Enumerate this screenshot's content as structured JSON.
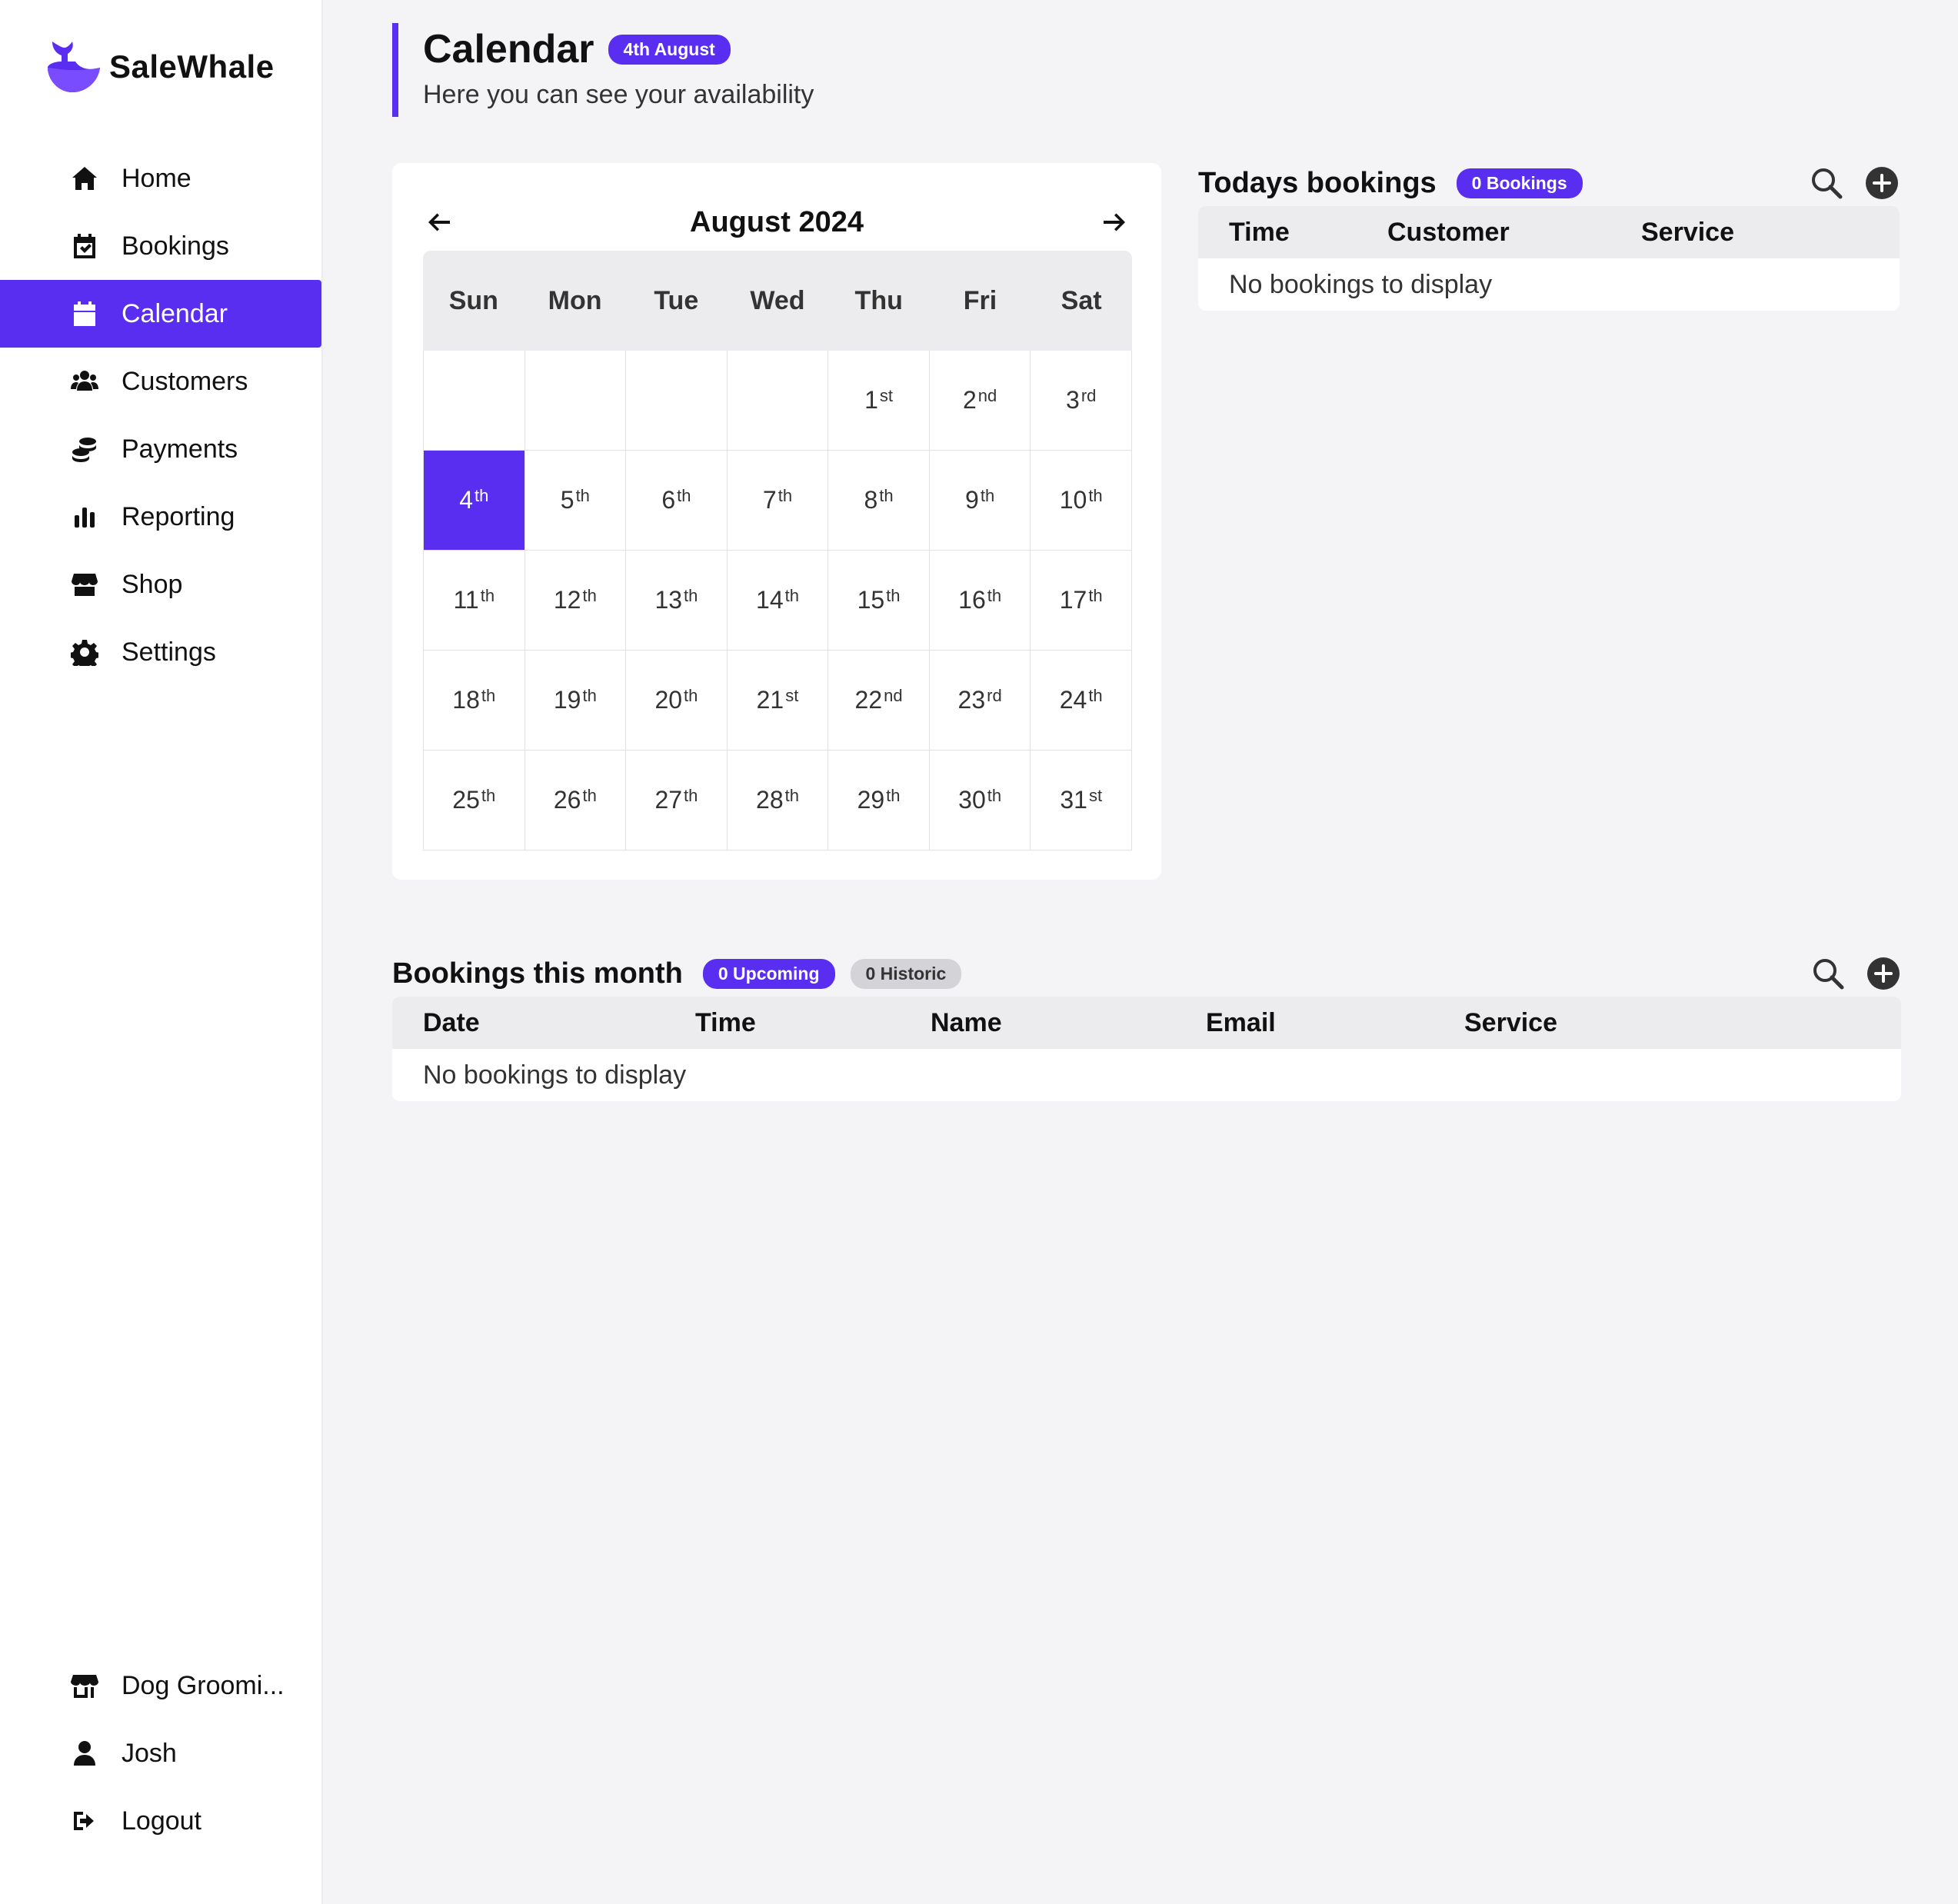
{
  "brand": {
    "name": "SaleWhale",
    "accent": "#5a2ef0"
  },
  "nav": {
    "items": [
      {
        "id": "home",
        "label": "Home",
        "icon": "home-icon"
      },
      {
        "id": "bookings",
        "label": "Bookings",
        "icon": "calendar-check-icon"
      },
      {
        "id": "calendar",
        "label": "Calendar",
        "icon": "calendar-icon",
        "active": true
      },
      {
        "id": "customers",
        "label": "Customers",
        "icon": "users-icon"
      },
      {
        "id": "payments",
        "label": "Payments",
        "icon": "coins-icon"
      },
      {
        "id": "reporting",
        "label": "Reporting",
        "icon": "bar-chart-icon"
      },
      {
        "id": "shop",
        "label": "Shop",
        "icon": "shop-icon"
      },
      {
        "id": "settings",
        "label": "Settings",
        "icon": "gear-icon"
      }
    ],
    "bottom": [
      {
        "id": "business",
        "label": "Dog Groomi...",
        "icon": "store-icon"
      },
      {
        "id": "user",
        "label": "Josh",
        "icon": "user-icon"
      },
      {
        "id": "logout",
        "label": "Logout",
        "icon": "logout-icon"
      }
    ]
  },
  "header": {
    "title": "Calendar",
    "date_badge": "4th August",
    "subtitle": "Here you can see your availability"
  },
  "calendar": {
    "month_label": "August 2024",
    "weekdays": [
      "Sun",
      "Mon",
      "Tue",
      "Wed",
      "Thu",
      "Fri",
      "Sat"
    ],
    "leading_blanks": 4,
    "days": [
      [
        "1",
        "st"
      ],
      [
        "2",
        "nd"
      ],
      [
        "3",
        "rd"
      ],
      [
        "4",
        "th"
      ],
      [
        "5",
        "th"
      ],
      [
        "6",
        "th"
      ],
      [
        "7",
        "th"
      ],
      [
        "8",
        "th"
      ],
      [
        "9",
        "th"
      ],
      [
        "10",
        "th"
      ],
      [
        "11",
        "th"
      ],
      [
        "12",
        "th"
      ],
      [
        "13",
        "th"
      ],
      [
        "14",
        "th"
      ],
      [
        "15",
        "th"
      ],
      [
        "16",
        "th"
      ],
      [
        "17",
        "th"
      ],
      [
        "18",
        "th"
      ],
      [
        "19",
        "th"
      ],
      [
        "20",
        "th"
      ],
      [
        "21",
        "st"
      ],
      [
        "22",
        "nd"
      ],
      [
        "23",
        "rd"
      ],
      [
        "24",
        "th"
      ],
      [
        "25",
        "th"
      ],
      [
        "26",
        "th"
      ],
      [
        "27",
        "th"
      ],
      [
        "28",
        "th"
      ],
      [
        "29",
        "th"
      ],
      [
        "30",
        "th"
      ],
      [
        "31",
        "st"
      ]
    ],
    "selected_day": 4
  },
  "today_bookings": {
    "title": "Todays bookings",
    "badge": "0 Bookings",
    "columns": [
      "Time",
      "Customer",
      "Service"
    ],
    "empty_text": "No bookings to display"
  },
  "month_bookings": {
    "title": "Bookings this month",
    "upcoming_badge": "0 Upcoming",
    "historic_badge": "0 Historic",
    "columns": [
      "Date",
      "Time",
      "Name",
      "Email",
      "Service"
    ],
    "empty_text": "No bookings to display"
  }
}
